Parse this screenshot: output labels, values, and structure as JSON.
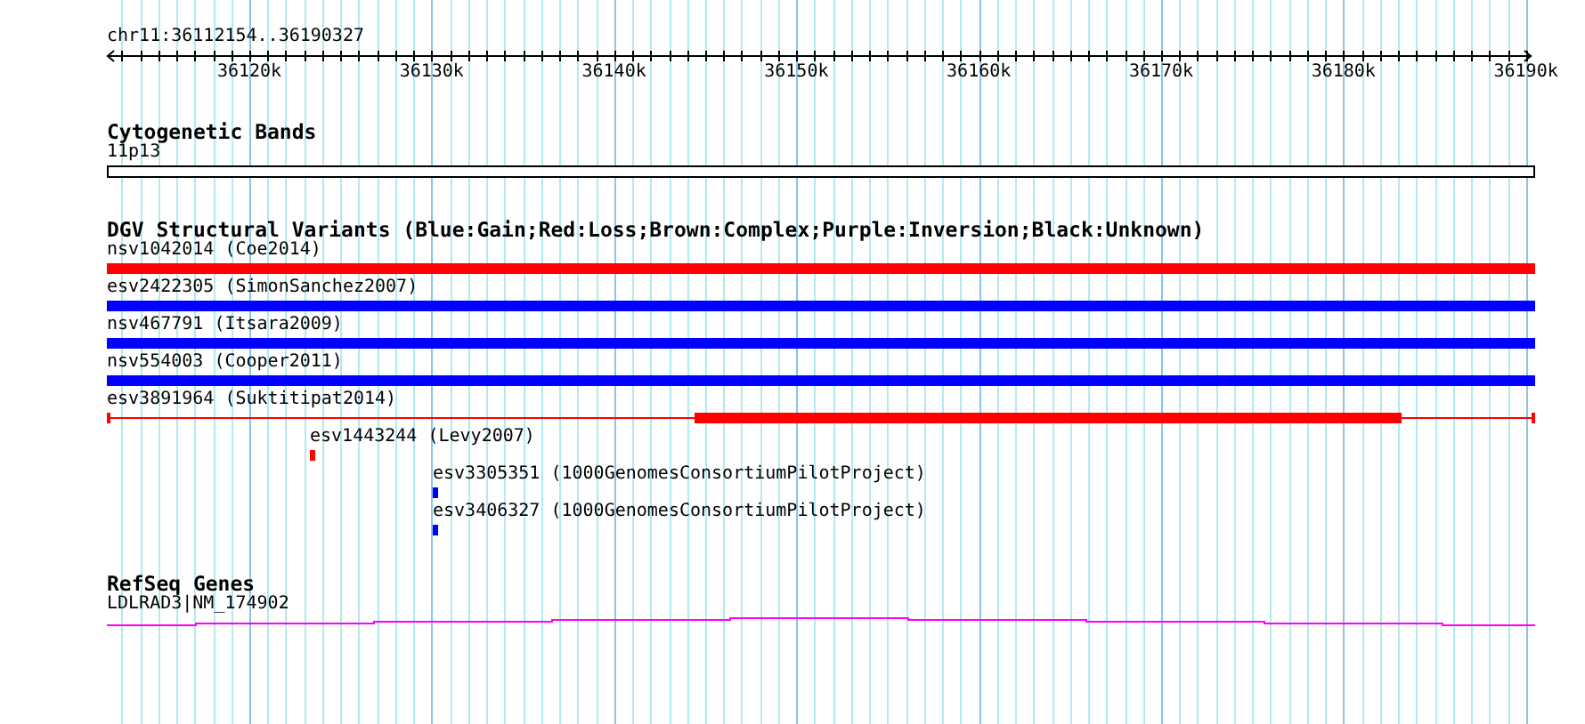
{
  "location": "chr11:36112154..36190327",
  "ruler": {
    "ticks": [
      "36120k",
      "36130k",
      "36140k",
      "36150k",
      "36160k",
      "36170k",
      "36180k",
      "36190k"
    ]
  },
  "tracks": [
    {
      "kind": "cytoband",
      "title": "Cytogenetic Bands",
      "features": [
        {
          "label": "11p13"
        }
      ]
    },
    {
      "kind": "variants",
      "title": "DGV Structural Variants (Blue:Gain;Red:Loss;Brown:Complex;Purple:Inversion;Black:Unknown)",
      "features": [
        {
          "kind": "bar",
          "label": "nsv1042014 (Coe2014)",
          "color": "#ff0000"
        },
        {
          "kind": "bar",
          "label": "esv2422305 (SimonSanchez2007)",
          "color": "#0000ff"
        },
        {
          "kind": "bar",
          "label": "nsv467791 (Itsara2009)",
          "color": "#0000ff"
        },
        {
          "kind": "bar",
          "label": "nsv554003 (Cooper2011)",
          "color": "#0000ff"
        },
        {
          "kind": "split",
          "label": "esv3891964 (Suktitipat2014)",
          "color": "#ff0000"
        },
        {
          "kind": "bar",
          "label": "esv1443244 (Levy2007)",
          "color": "#ff0000"
        },
        {
          "kind": "bar",
          "label": "esv3305351 (1000GenomesConsortiumPilotProject)",
          "color": "#0000ff"
        },
        {
          "kind": "bar",
          "label": "esv3406327 (1000GenomesConsortiumPilotProject)",
          "color": "#0000ff"
        }
      ]
    },
    {
      "kind": "genes",
      "title": "RefSeq Genes",
      "features": [
        {
          "label": "LDLRAD3|NM_174902"
        }
      ]
    }
  ]
}
